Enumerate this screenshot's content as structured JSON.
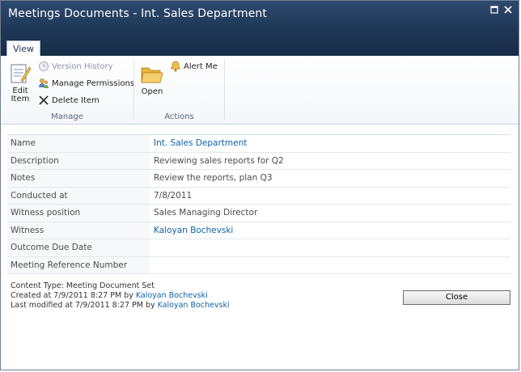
{
  "window": {
    "title": "Meetings Documents - Int. Sales Department"
  },
  "ribbon": {
    "tabs": [
      {
        "label": "View"
      }
    ],
    "manage": {
      "label": "Manage",
      "edit_label_1": "Edit",
      "edit_label_2": "Item",
      "version_history": "Version History",
      "manage_permissions": "Manage Permissions",
      "delete_item": "Delete Item"
    },
    "actions": {
      "label": "Actions",
      "open": "Open",
      "alert_me": "Alert Me"
    }
  },
  "fields": [
    {
      "label": "Name",
      "value": "Int. Sales Department"
    },
    {
      "label": "Description",
      "value": "Reviewing sales reports for Q2"
    },
    {
      "label": "Notes",
      "value": "Review the reports, plan Q3"
    },
    {
      "label": "Conducted at",
      "value": "7/8/2011"
    },
    {
      "label": "Witness position",
      "value": "Sales Managing Director"
    },
    {
      "label": "Witness",
      "value": "Kaloyan Bochevski"
    },
    {
      "label": "Outcome Due Date",
      "value": ""
    },
    {
      "label": "Meeting Reference Number",
      "value": ""
    }
  ],
  "footer": {
    "content_type": "Content Type: Meeting Document Set",
    "created_prefix": "Created at 7/9/2011 8:27 PM by ",
    "created_by": "Kaloyan Bochevski",
    "modified_prefix": "Last modified at 7/9/2011 8:27 PM by ",
    "modified_by": "Kaloyan Bochevski"
  },
  "buttons": {
    "close": "Close"
  },
  "icons": {
    "edit": "edit-item-icon",
    "version": "version-history-icon",
    "permissions": "manage-permissions-icon",
    "delete": "delete-item-icon",
    "open": "folder-open-icon",
    "alert": "alert-me-icon",
    "maximize": "maximize-icon",
    "close": "close-icon"
  },
  "colors": {
    "titlebar": "#1e3655",
    "link": "#0f63a6"
  }
}
